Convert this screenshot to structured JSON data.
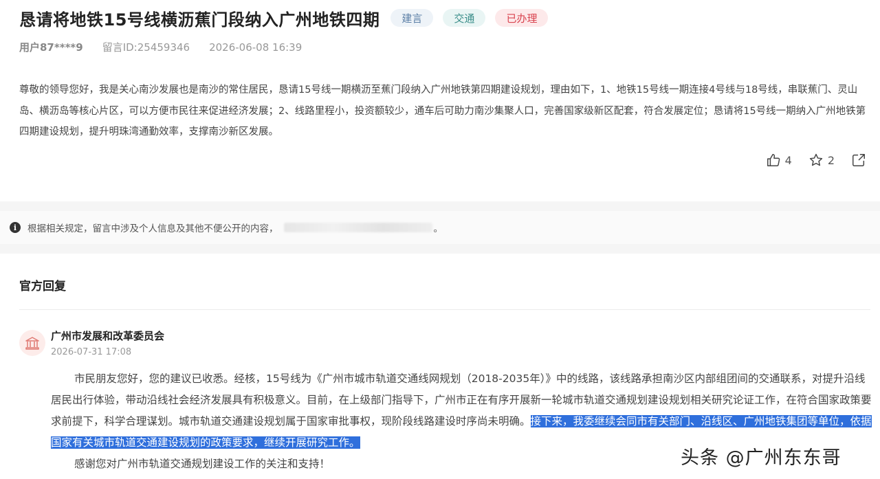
{
  "header": {
    "title": "恳请将地铁15号线横沥蕉门段纳入广州地铁四期",
    "tags": [
      "建言",
      "交通",
      "已办理"
    ],
    "tag_colors": [
      "#5b7fa6",
      "#3b8e8a",
      "#d9434f"
    ]
  },
  "meta": {
    "user": "用户87****9",
    "message_id": "留言ID:25459346",
    "time": "2026-06-08 16:39"
  },
  "message": {
    "text": "尊敬的领导您好，我是关心南沙发展也是南沙的常住居民，恳请15号线一期横沥至蕉门段纳入广州地铁第四期建设规划，理由如下，1、地铁15号线一期连接4号线与18号线，串联蕉门、灵山岛、横沥岛等核心片区，可以方便市民往来促进经济发展；2、线路里程小，投资额较少，通车后可助力南沙集聚人口，完善国家级新区配套，符合发展定位；恳请将15号线一期纳入广州地铁第四期建设规划，提升明珠湾通勤效率，支撑南沙新区发展。"
  },
  "actions": {
    "like_icon": "thumbs-up-icon",
    "like_count": "4",
    "favorite_icon": "star-icon",
    "favorite_count": "2",
    "share_icon": "share-icon"
  },
  "notice": {
    "icon": "info-icon",
    "icon_glyph": "i",
    "text": "根据相关规定，留言中涉及个人信息及其他不便公开的内容，",
    "end": "。"
  },
  "reply_section": {
    "title": "官方回复",
    "org_name": "广州市发展和改革委员会",
    "org_time": "2026-07-31 17:08",
    "org_icon": "government-building-icon",
    "paragraph_normal": "市民朋友您好，您的建议已收悉。经核，15号线为《广州市城市轨道交通线网规划（2018-2035年）》中的线路，该线路承担南沙区内部组团间的交通联系，对提升沿线居民出行体验，带动沿线社会经济发展具有积极意义。目前，在上级部门指导下，广州市正在有序开展新一轮城市轨道交通规划建设规划相关研究论证工作，在符合国家政策要求前提下，科学合理谋划。城市轨道交通建设规划属于国家审批事权，现阶段线路建设时序尚未明确。",
    "paragraph_highlight": "接下来，我委继续会同市有关部门、沿线区、广州地铁集团等单位，依据国家有关城市轨道交通建设规划的政策要求，继续开展研究工作。",
    "thanks": "感谢您对广州市轨道交通规划建设工作的关注和支持！",
    "highlight_color": "#2f6fdc"
  },
  "watermark": {
    "text": "头条 @广州东东哥"
  }
}
